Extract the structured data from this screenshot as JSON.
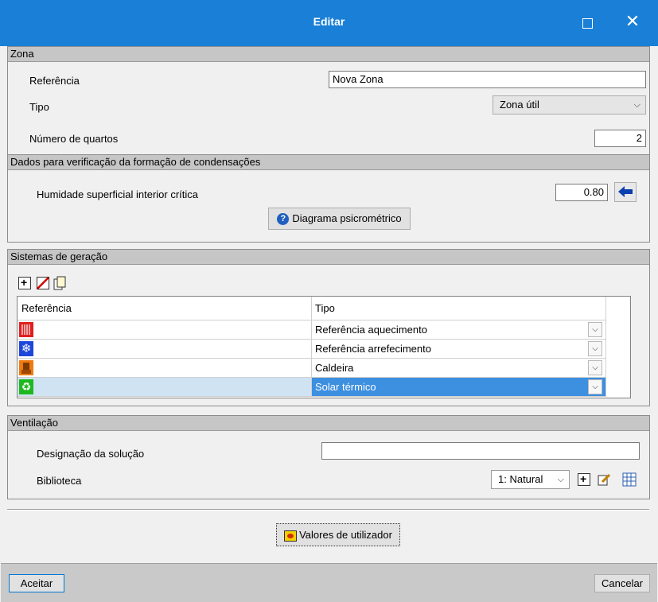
{
  "window": {
    "title": "Editar"
  },
  "zona": {
    "header": "Zona",
    "referencia_label": "Referência",
    "referencia_value": "Nova Zona",
    "tipo_label": "Tipo",
    "tipo_value": "Zona útil",
    "quartos_label": "Número de quartos",
    "quartos_value": "2"
  },
  "condensacoes": {
    "header": "Dados para verificação da formação de condensações",
    "humidade_label": "Humidade superficial interior crítica",
    "humidade_value": "0.80",
    "diagrama_button": "Diagrama psicrométrico"
  },
  "sistemas": {
    "header": "Sistemas de geração",
    "columns": [
      "Referência",
      "Tipo"
    ],
    "rows": [
      {
        "icon": "radiator-icon",
        "referencia": "",
        "tipo": "Referência aquecimento",
        "selected": false
      },
      {
        "icon": "snowflake-icon",
        "referencia": "",
        "tipo": "Referência arrefecimento",
        "selected": false
      },
      {
        "icon": "boiler-icon",
        "referencia": "",
        "tipo": "Caldeira",
        "selected": false
      },
      {
        "icon": "recycle-icon",
        "referencia": "",
        "tipo": "Solar térmico",
        "selected": true
      }
    ]
  },
  "ventilacao": {
    "header": "Ventilação",
    "designacao_label": "Designação da solução",
    "designacao_value": "",
    "biblioteca_label": "Biblioteca",
    "biblioteca_value": "1: Natural"
  },
  "footer": {
    "valores_button": "Valores de utilizador",
    "aceitar_button": "Aceitar",
    "cancelar_button": "Cancelar"
  },
  "colors": {
    "titlebar": "#1a7fd6",
    "selection": "#3d8fe0",
    "selection_light": "#cfe3f3"
  }
}
